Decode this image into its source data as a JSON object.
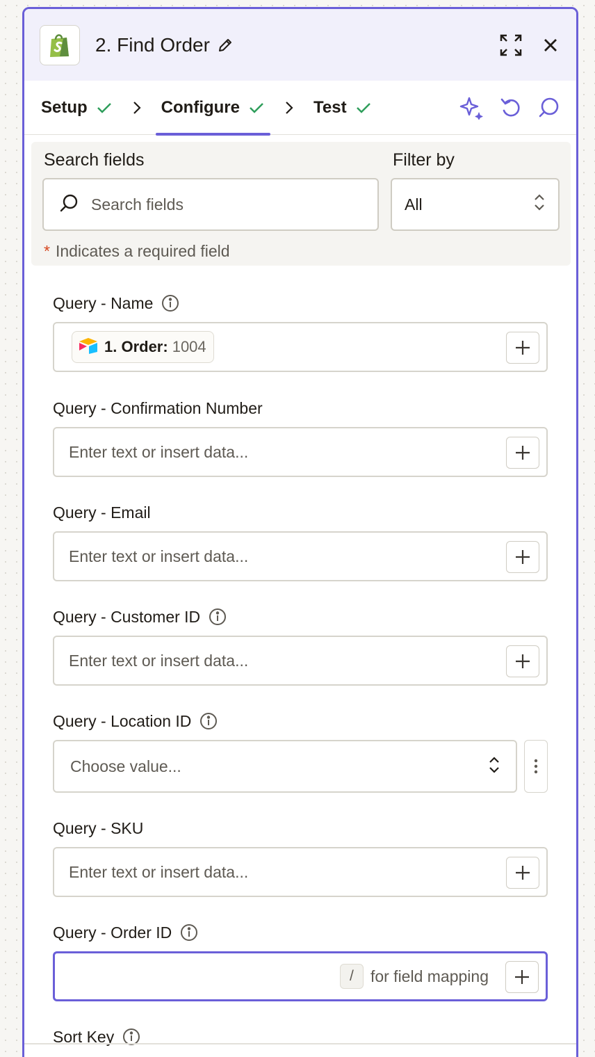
{
  "header": {
    "title": "2. Find Order",
    "app_icon": "shopify-icon",
    "edit_icon": "pencil-icon",
    "expand_icon": "expand-icon",
    "close_icon": "close-icon"
  },
  "tabs": [
    {
      "label": "Setup",
      "complete": true
    },
    {
      "label": "Configure",
      "complete": true,
      "active": true
    },
    {
      "label": "Test",
      "complete": true
    }
  ],
  "tab_actions": [
    "sparkle-icon",
    "undo-icon",
    "comment-icon"
  ],
  "filter": {
    "search_label": "Search fields",
    "search_placeholder": "Search fields",
    "filter_label": "Filter by",
    "filter_value": "All",
    "required_star": "*",
    "required_note": "Indicates a required field"
  },
  "fields": {
    "name": {
      "label": "Query - Name",
      "pill_step": "1. Order:",
      "pill_value": "1004"
    },
    "confirmation": {
      "label": "Query - Confirmation Number",
      "placeholder": "Enter text or insert data..."
    },
    "email": {
      "label": "Query - Email",
      "placeholder": "Enter text or insert data..."
    },
    "customer": {
      "label": "Query - Customer ID",
      "placeholder": "Enter text or insert data..."
    },
    "location": {
      "label": "Query - Location ID",
      "placeholder": "Choose value..."
    },
    "sku": {
      "label": "Query - SKU",
      "placeholder": "Enter text or insert data..."
    },
    "order": {
      "label": "Query - Order ID",
      "slash": "/",
      "hint": "for field mapping"
    },
    "sort": {
      "label": "Sort Key"
    }
  },
  "colors": {
    "accent": "#6a5fd8",
    "check": "#2e9e5b",
    "required": "#d6461f",
    "shopify": "#95bf47"
  }
}
